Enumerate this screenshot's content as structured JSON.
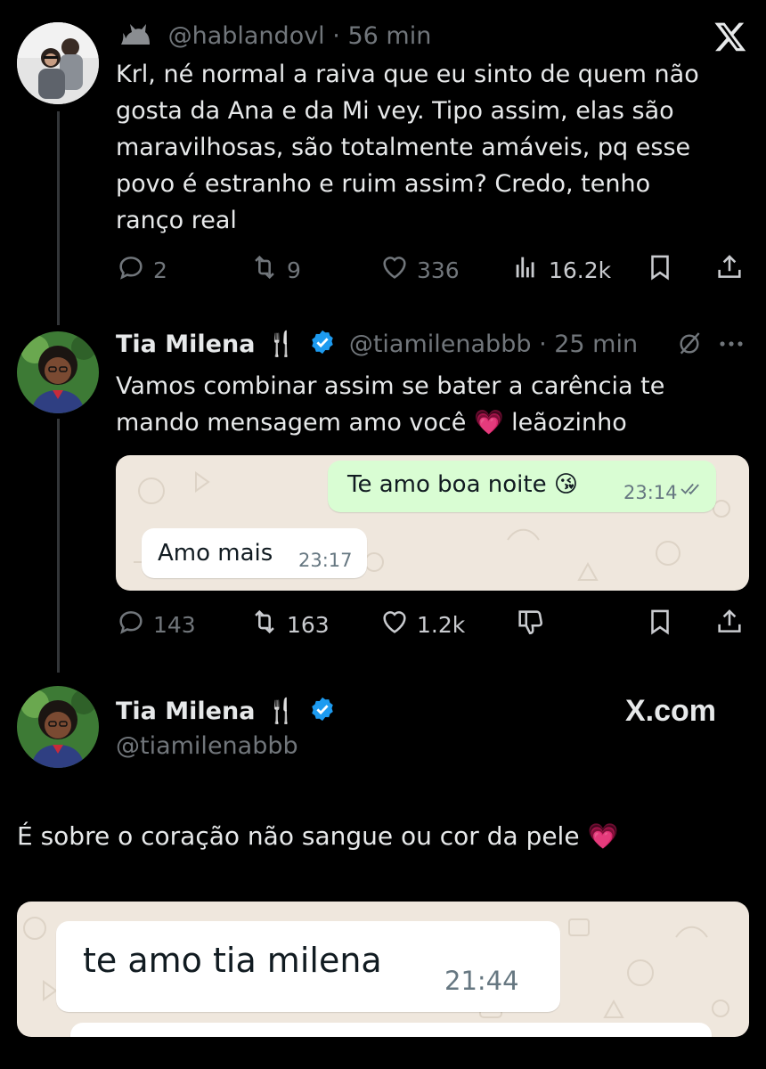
{
  "tweet1": {
    "handle": "@hablandovl",
    "time": "56 min",
    "text_lines": [
      "Krl, né normal a raiva que eu sinto de quem não",
      "gosta da Ana e da Mi vey. Tipo assim, elas são",
      "maravilhosas, são totalmente amáveis, pq esse",
      "povo é estranho e ruim assim? Credo, tenho",
      "ranço real"
    ],
    "replies": "2",
    "reposts": "9",
    "likes": "336",
    "views": "16.2k"
  },
  "tweet2": {
    "name": "Tia Milena",
    "emoji": "🍴",
    "handle": "@tiamilenabbb",
    "time": "25 min",
    "text_lines": [
      "Vamos combinar assim se bater a carência te",
      "mando mensagem amo você 💗 leãozinho"
    ],
    "chat": {
      "out_text": "Te amo boa noite 😘",
      "out_time": "23:14",
      "in_text": "Amo mais",
      "in_time": "23:17"
    },
    "replies": "143",
    "reposts": "163",
    "likes": "1.2k"
  },
  "tweet3": {
    "name": "Tia Milena",
    "emoji": "🍴",
    "handle": "@tiamilenabbb",
    "watermark": "X.com",
    "text": "É sobre o coração não sangue ou cor da pele 💗",
    "chat": {
      "in_text": "te amo tia milena",
      "in_time": "21:44"
    }
  },
  "colors": {
    "background": "#000000",
    "text": "#e7e9ea",
    "muted": "#71767b",
    "verified": "#1d9bf0",
    "wa_bg": "#efe7dd",
    "wa_out": "#d9fdd3"
  },
  "icons": [
    "cat-icon",
    "x-logo-icon",
    "reply-icon",
    "repost-icon",
    "like-icon",
    "views-icon",
    "bookmark-icon",
    "share-icon",
    "verified-icon",
    "grok-icon",
    "more-icon",
    "dislike-icon",
    "fork-knife-icon"
  ]
}
